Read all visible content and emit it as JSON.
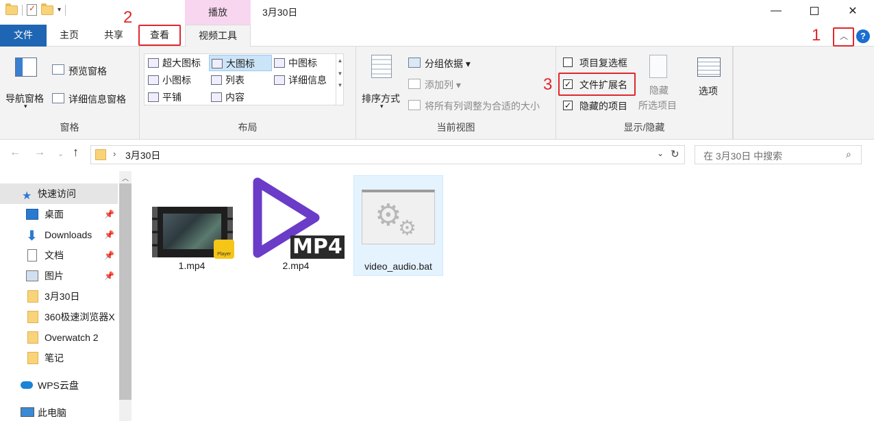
{
  "window": {
    "title": "3月30日",
    "contextual_tab": "播放"
  },
  "tabs": {
    "file": "文件",
    "home": "主页",
    "share": "共享",
    "view": "查看",
    "video_tools": "视频工具"
  },
  "annotations": {
    "n1": "1",
    "n2": "2",
    "n3": "3"
  },
  "ribbon": {
    "pane": {
      "label": "窗格",
      "navigation_pane": "导航窗格",
      "preview_pane": "预览窗格",
      "details_pane": "详细信息窗格"
    },
    "layout": {
      "label": "布局",
      "items": [
        "超大图标",
        "大图标",
        "中图标",
        "小图标",
        "列表",
        "详细信息",
        "平铺",
        "内容"
      ],
      "selected": "大图标"
    },
    "current_view": {
      "label": "当前视图",
      "sort_by": "排序方式",
      "group_by": "分组依据",
      "add_columns": "添加列",
      "size_columns": "将所有列调整为合适的大小"
    },
    "show_hide": {
      "label": "显示/隐藏",
      "item_check_boxes": "项目复选框",
      "item_check_boxes_checked": false,
      "file_name_extensions": "文件扩展名",
      "file_name_extensions_checked": true,
      "hidden_items": "隐藏的项目",
      "hidden_items_checked": true,
      "hide_selected_1": "隐藏",
      "hide_selected_2": "所选项目"
    },
    "options": "选项"
  },
  "address": {
    "path": "3月30日",
    "search_placeholder": "在 3月30日 中搜索"
  },
  "nav_pane": {
    "items": [
      {
        "label": "快速访问",
        "icon": "star-icon",
        "pinned": false
      },
      {
        "label": "桌面",
        "icon": "desktop-icon",
        "pinned": true
      },
      {
        "label": "Downloads",
        "icon": "download-icon",
        "pinned": true
      },
      {
        "label": "文档",
        "icon": "document-icon",
        "pinned": true
      },
      {
        "label": "图片",
        "icon": "picture-icon",
        "pinned": true
      },
      {
        "label": "3月30日",
        "icon": "folder-icon",
        "pinned": false
      },
      {
        "label": "360极速浏览器X",
        "icon": "folder-icon",
        "pinned": false
      },
      {
        "label": "Overwatch 2",
        "icon": "folder-icon",
        "pinned": false
      },
      {
        "label": "笔记",
        "icon": "folder-icon",
        "pinned": false
      },
      {
        "label": "WPS云盘",
        "icon": "cloud-icon",
        "pinned": false
      },
      {
        "label": "此电脑",
        "icon": "computer-icon",
        "pinned": false
      }
    ]
  },
  "files": [
    {
      "name": "1.mp4",
      "badge": "Player"
    },
    {
      "name": "2.mp4",
      "badge": "MP4"
    },
    {
      "name": "video_audio.bat"
    }
  ],
  "colors": {
    "file_tab": "#1e65b3",
    "context_tab": "#f9d6f0",
    "annotation_red": "#e0262c",
    "mp4_purple": "#6a3cc8"
  }
}
